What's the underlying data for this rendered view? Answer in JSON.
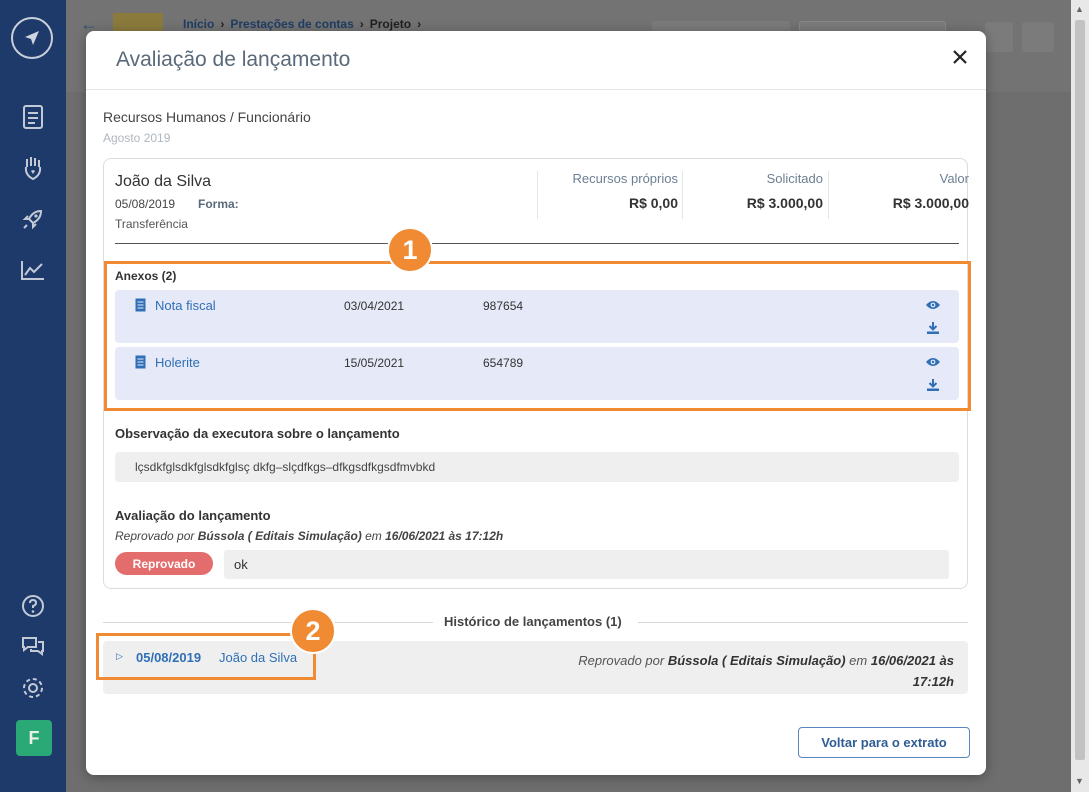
{
  "background": {
    "breadcrumb": [
      "Início",
      "Prestações de contas",
      "Projeto"
    ],
    "avatar_letter": "F"
  },
  "modal": {
    "title": "Avaliação de lançamento",
    "category": "Recursos Humanos / Funcionário",
    "period": "Agosto 2019",
    "entry": {
      "name": "João da Silva",
      "date": "05/08/2019",
      "forma_label": "Forma:",
      "forma_value": "Transferência",
      "columns": [
        {
          "label": "Recursos próprios",
          "value": "R$ 0,00"
        },
        {
          "label": "Solicitado",
          "value": "R$ 3.000,00"
        },
        {
          "label": "Valor",
          "value": "R$ 3.000,00"
        }
      ]
    },
    "attachments": {
      "title": "Anexos (2)",
      "items": [
        {
          "name": "Nota fiscal",
          "date": "03/04/2021",
          "number": "987654"
        },
        {
          "name": "Holerite",
          "date": "15/05/2021",
          "number": "654789"
        }
      ]
    },
    "observation": {
      "title": "Observação da executora sobre o lançamento",
      "text": "lçsdkfglsdkfglsdkfglsç dkfg–slçdfkgs–dfkgsdfkgsdfmvbkd"
    },
    "evaluation": {
      "title": "Avaliação do lançamento",
      "by_prefix": "Reprovado por ",
      "by_who": "Bússola ( Editais Simulação)",
      "by_mid": " em ",
      "by_when": "16/06/2021 às 17:12h",
      "status": "Reprovado",
      "comment": "ok"
    },
    "history": {
      "title": "Histórico de lançamentos (1)",
      "rows": [
        {
          "date": "05/08/2019",
          "name": "João da Silva",
          "status_prefix": "Reprovado por ",
          "status_who": "Bússola ( Editais Simulação)",
          "status_mid": " em ",
          "status_when": "16/06/2021 às 17:12h"
        }
      ]
    },
    "back_button": "Voltar para o extrato"
  },
  "callouts": [
    "1",
    "2"
  ],
  "colors": {
    "accent": "#f08a33",
    "link": "#2f6fb5",
    "rejected": "#e36d6d",
    "sidebar": "#1d3a6b"
  }
}
